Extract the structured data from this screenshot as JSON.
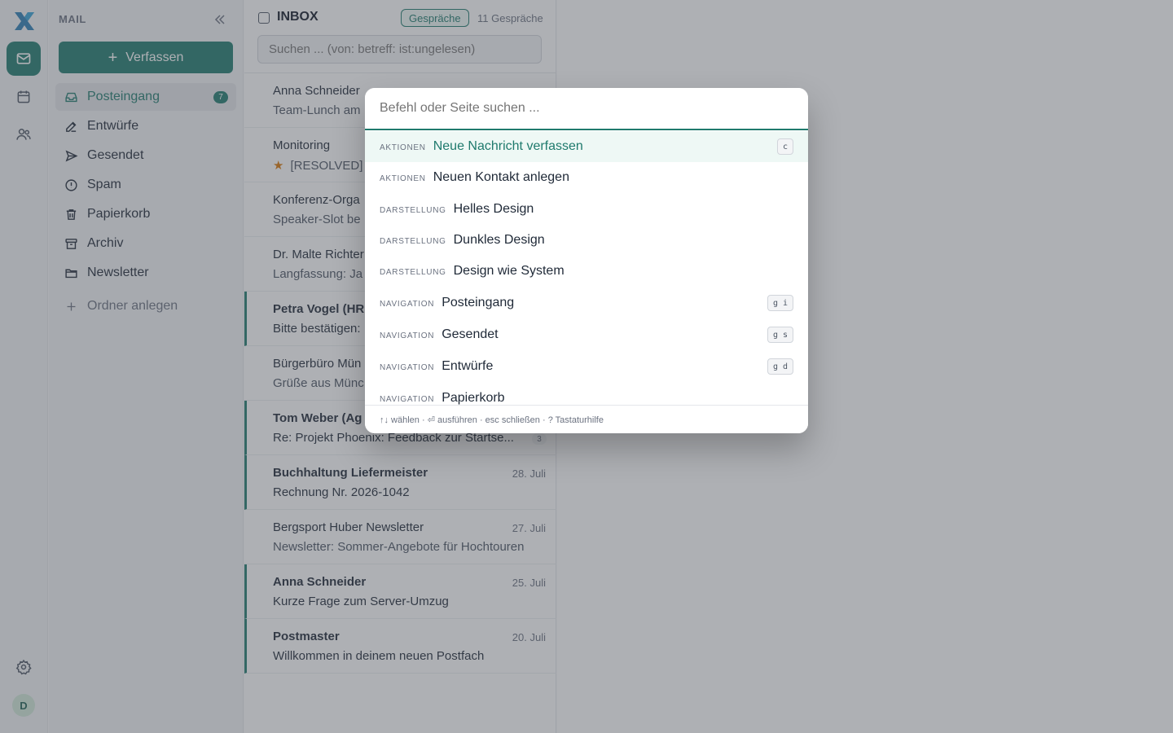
{
  "rail": {
    "avatar_initial": "D"
  },
  "sidebar": {
    "heading": "MAIL",
    "compose_label": "Verfassen",
    "folders": [
      {
        "label": "Posteingang",
        "badge": "7",
        "icon": "inbox-icon"
      },
      {
        "label": "Entwürfe",
        "icon": "pencil-icon"
      },
      {
        "label": "Gesendet",
        "icon": "send-icon"
      },
      {
        "label": "Spam",
        "icon": "alert-circle-icon"
      },
      {
        "label": "Papierkorb",
        "icon": "trash-icon"
      },
      {
        "label": "Archiv",
        "icon": "archive-icon"
      },
      {
        "label": "Newsletter",
        "icon": "folder-icon"
      }
    ],
    "add_folder_label": "Ordner anlegen"
  },
  "list": {
    "title": "INBOX",
    "conversations_chip": "Gespräche",
    "count": "11 Gespräche",
    "search_placeholder": "Suchen ... (von: betreff: ist:ungelesen)",
    "rows": [
      {
        "from": "Anna Schneider",
        "subject": "Team-Lunch am",
        "date": "",
        "unread": false
      },
      {
        "from": "Monitoring",
        "subject": "[RESOLVED]",
        "date": "",
        "unread": false,
        "starred": true
      },
      {
        "from": "Konferenz-Orga",
        "subject": "Speaker-Slot be",
        "date": "",
        "unread": false
      },
      {
        "from": "Dr. Malte Richter",
        "subject": "Langfassung: Ja",
        "date": "",
        "unread": false
      },
      {
        "from": "Petra Vogel (HR",
        "subject": "Bitte bestätigen:",
        "date": "",
        "unread": true
      },
      {
        "from": "Bürgerbüro Mün",
        "subject": "Grüße aus Münc",
        "date": "",
        "unread": false
      },
      {
        "from": "Tom Weber (Ag",
        "subject": "Re: Projekt Phoenix: Feedback zur Startse...",
        "date": "",
        "unread": true,
        "thread_count": "3"
      },
      {
        "from": "Buchhaltung Liefermeister",
        "subject": "Rechnung Nr. 2026-1042",
        "date": "28. Juli",
        "unread": true
      },
      {
        "from": "Bergsport Huber Newsletter",
        "subject": "Newsletter: Sommer-Angebote für Hochtouren",
        "date": "27. Juli",
        "unread": false
      },
      {
        "from": "Anna Schneider",
        "subject": "Kurze Frage zum Server-Umzug",
        "date": "25. Juli",
        "unread": true
      },
      {
        "from": "Postmaster",
        "subject": "Willkommen in deinem neuen Postfach",
        "date": "20. Juli",
        "unread": true
      }
    ]
  },
  "palette": {
    "placeholder": "Befehl oder Seite suchen ...",
    "commands": [
      {
        "category": "AKTIONEN",
        "label": "Neue Nachricht verfassen",
        "keys": [
          "c"
        ],
        "active": true
      },
      {
        "category": "AKTIONEN",
        "label": "Neuen Kontakt anlegen",
        "keys": []
      },
      {
        "category": "DARSTELLUNG",
        "label": "Helles Design",
        "keys": []
      },
      {
        "category": "DARSTELLUNG",
        "label": "Dunkles Design",
        "keys": []
      },
      {
        "category": "DARSTELLUNG",
        "label": "Design wie System",
        "keys": []
      },
      {
        "category": "NAVIGATION",
        "label": "Posteingang",
        "keys": [
          "g",
          "i"
        ]
      },
      {
        "category": "NAVIGATION",
        "label": "Gesendet",
        "keys": [
          "g",
          "s"
        ]
      },
      {
        "category": "NAVIGATION",
        "label": "Entwürfe",
        "keys": [
          "g",
          "d"
        ]
      },
      {
        "category": "NAVIGATION",
        "label": "Papierkorb",
        "keys": []
      }
    ],
    "footer": "↑↓ wählen · ⏎ ausführen · esc schließen · ? Tastaturhilfe"
  },
  "colors": {
    "accent": "#1f7a6d",
    "unread_bar": "#1f7a6d",
    "star": "#d97706"
  }
}
